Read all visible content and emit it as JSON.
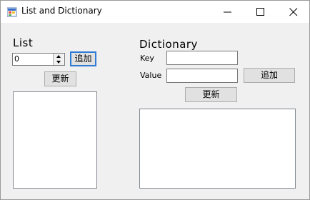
{
  "window": {
    "title": "List and Dictionary"
  },
  "list_panel": {
    "heading": "List",
    "numeric_value": "0",
    "add_button": "追加",
    "update_button": "更新"
  },
  "dictionary_panel": {
    "heading": "Dictionary",
    "key_label": "Key",
    "value_label": "Value",
    "key_value": "",
    "value_value": "",
    "add_button": "追加",
    "update_button": "更新"
  },
  "icons": {
    "app": "app-icon",
    "minimize": "minimize-icon",
    "maximize": "maximize-icon",
    "close": "close-icon"
  },
  "colors": {
    "default_button_border": "#2f7bd5",
    "window_background": "#f0f0f0"
  }
}
